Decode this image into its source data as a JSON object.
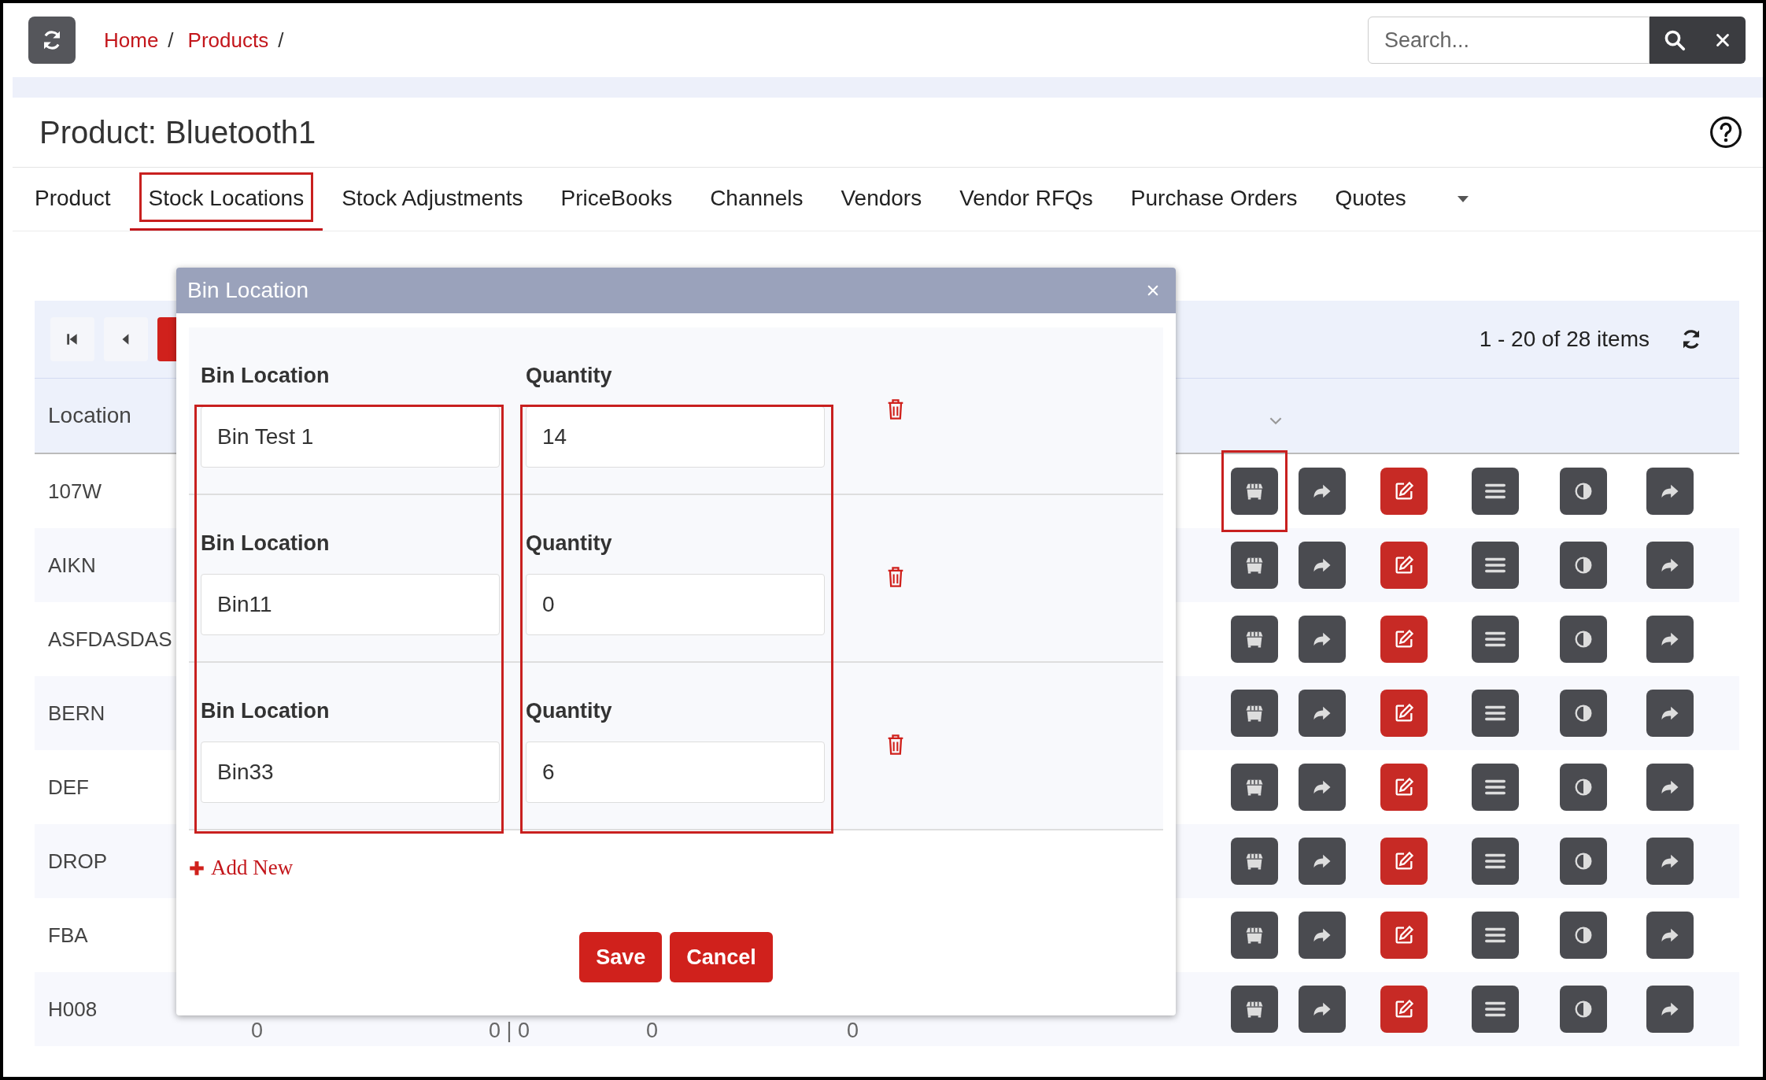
{
  "topbar": {
    "breadcrumb": [
      {
        "label": "Home",
        "separator": "/"
      },
      {
        "label": "Products",
        "separator": "/"
      }
    ],
    "search": {
      "placeholder": "Search..."
    }
  },
  "page_title": "Product: Bluetooth1",
  "tabs": [
    {
      "label": "Product",
      "selected": false,
      "highlighted": false
    },
    {
      "label": "Stock Locations",
      "selected": true,
      "highlighted": true
    },
    {
      "label": "Stock Adjustments",
      "selected": false,
      "highlighted": false
    },
    {
      "label": "PriceBooks",
      "selected": false,
      "highlighted": false
    },
    {
      "label": "Channels",
      "selected": false,
      "highlighted": false
    },
    {
      "label": "Vendors",
      "selected": false,
      "highlighted": false
    },
    {
      "label": "Vendor RFQs",
      "selected": false,
      "highlighted": false
    },
    {
      "label": "Purchase Orders",
      "selected": false,
      "highlighted": false
    },
    {
      "label": "Quotes",
      "selected": false,
      "highlighted": false
    }
  ],
  "grid": {
    "summary": "1 - 20 of 28 items",
    "columns": [
      {
        "label": "Location"
      }
    ],
    "row_actions": [
      {
        "kind": "bin"
      },
      {
        "kind": "forward"
      },
      {
        "kind": "edit"
      },
      {
        "kind": "list"
      },
      {
        "kind": "contrast"
      },
      {
        "kind": "share"
      }
    ],
    "rows": [
      {
        "location": "107W",
        "highlighted": true
      },
      {
        "location": "AIKN",
        "highlighted": false
      },
      {
        "location": "ASFDASDAS",
        "highlighted": false
      },
      {
        "location": "BERN",
        "highlighted": false
      },
      {
        "location": "DEF",
        "highlighted": false
      },
      {
        "location": "DROP",
        "highlighted": false
      },
      {
        "location": "FBA",
        "highlighted": false
      },
      {
        "location": "H008",
        "highlighted": false,
        "values": [
          "0",
          "0 | 0",
          "0",
          "0"
        ]
      }
    ]
  },
  "modal": {
    "title": "Bin Location",
    "entries": [
      {
        "bin_label": "Bin Location",
        "bin_value": "Bin Test 1",
        "qty_label": "Quantity",
        "qty_value": "14"
      },
      {
        "bin_label": "Bin Location",
        "bin_value": "Bin11",
        "qty_label": "Quantity",
        "qty_value": "0"
      },
      {
        "bin_label": "Bin Location",
        "bin_value": "Bin33",
        "qty_label": "Quantity",
        "qty_value": "6"
      }
    ],
    "add_label": "Add New",
    "buttons": [
      {
        "label": "Save"
      },
      {
        "label": "Cancel"
      }
    ]
  }
}
